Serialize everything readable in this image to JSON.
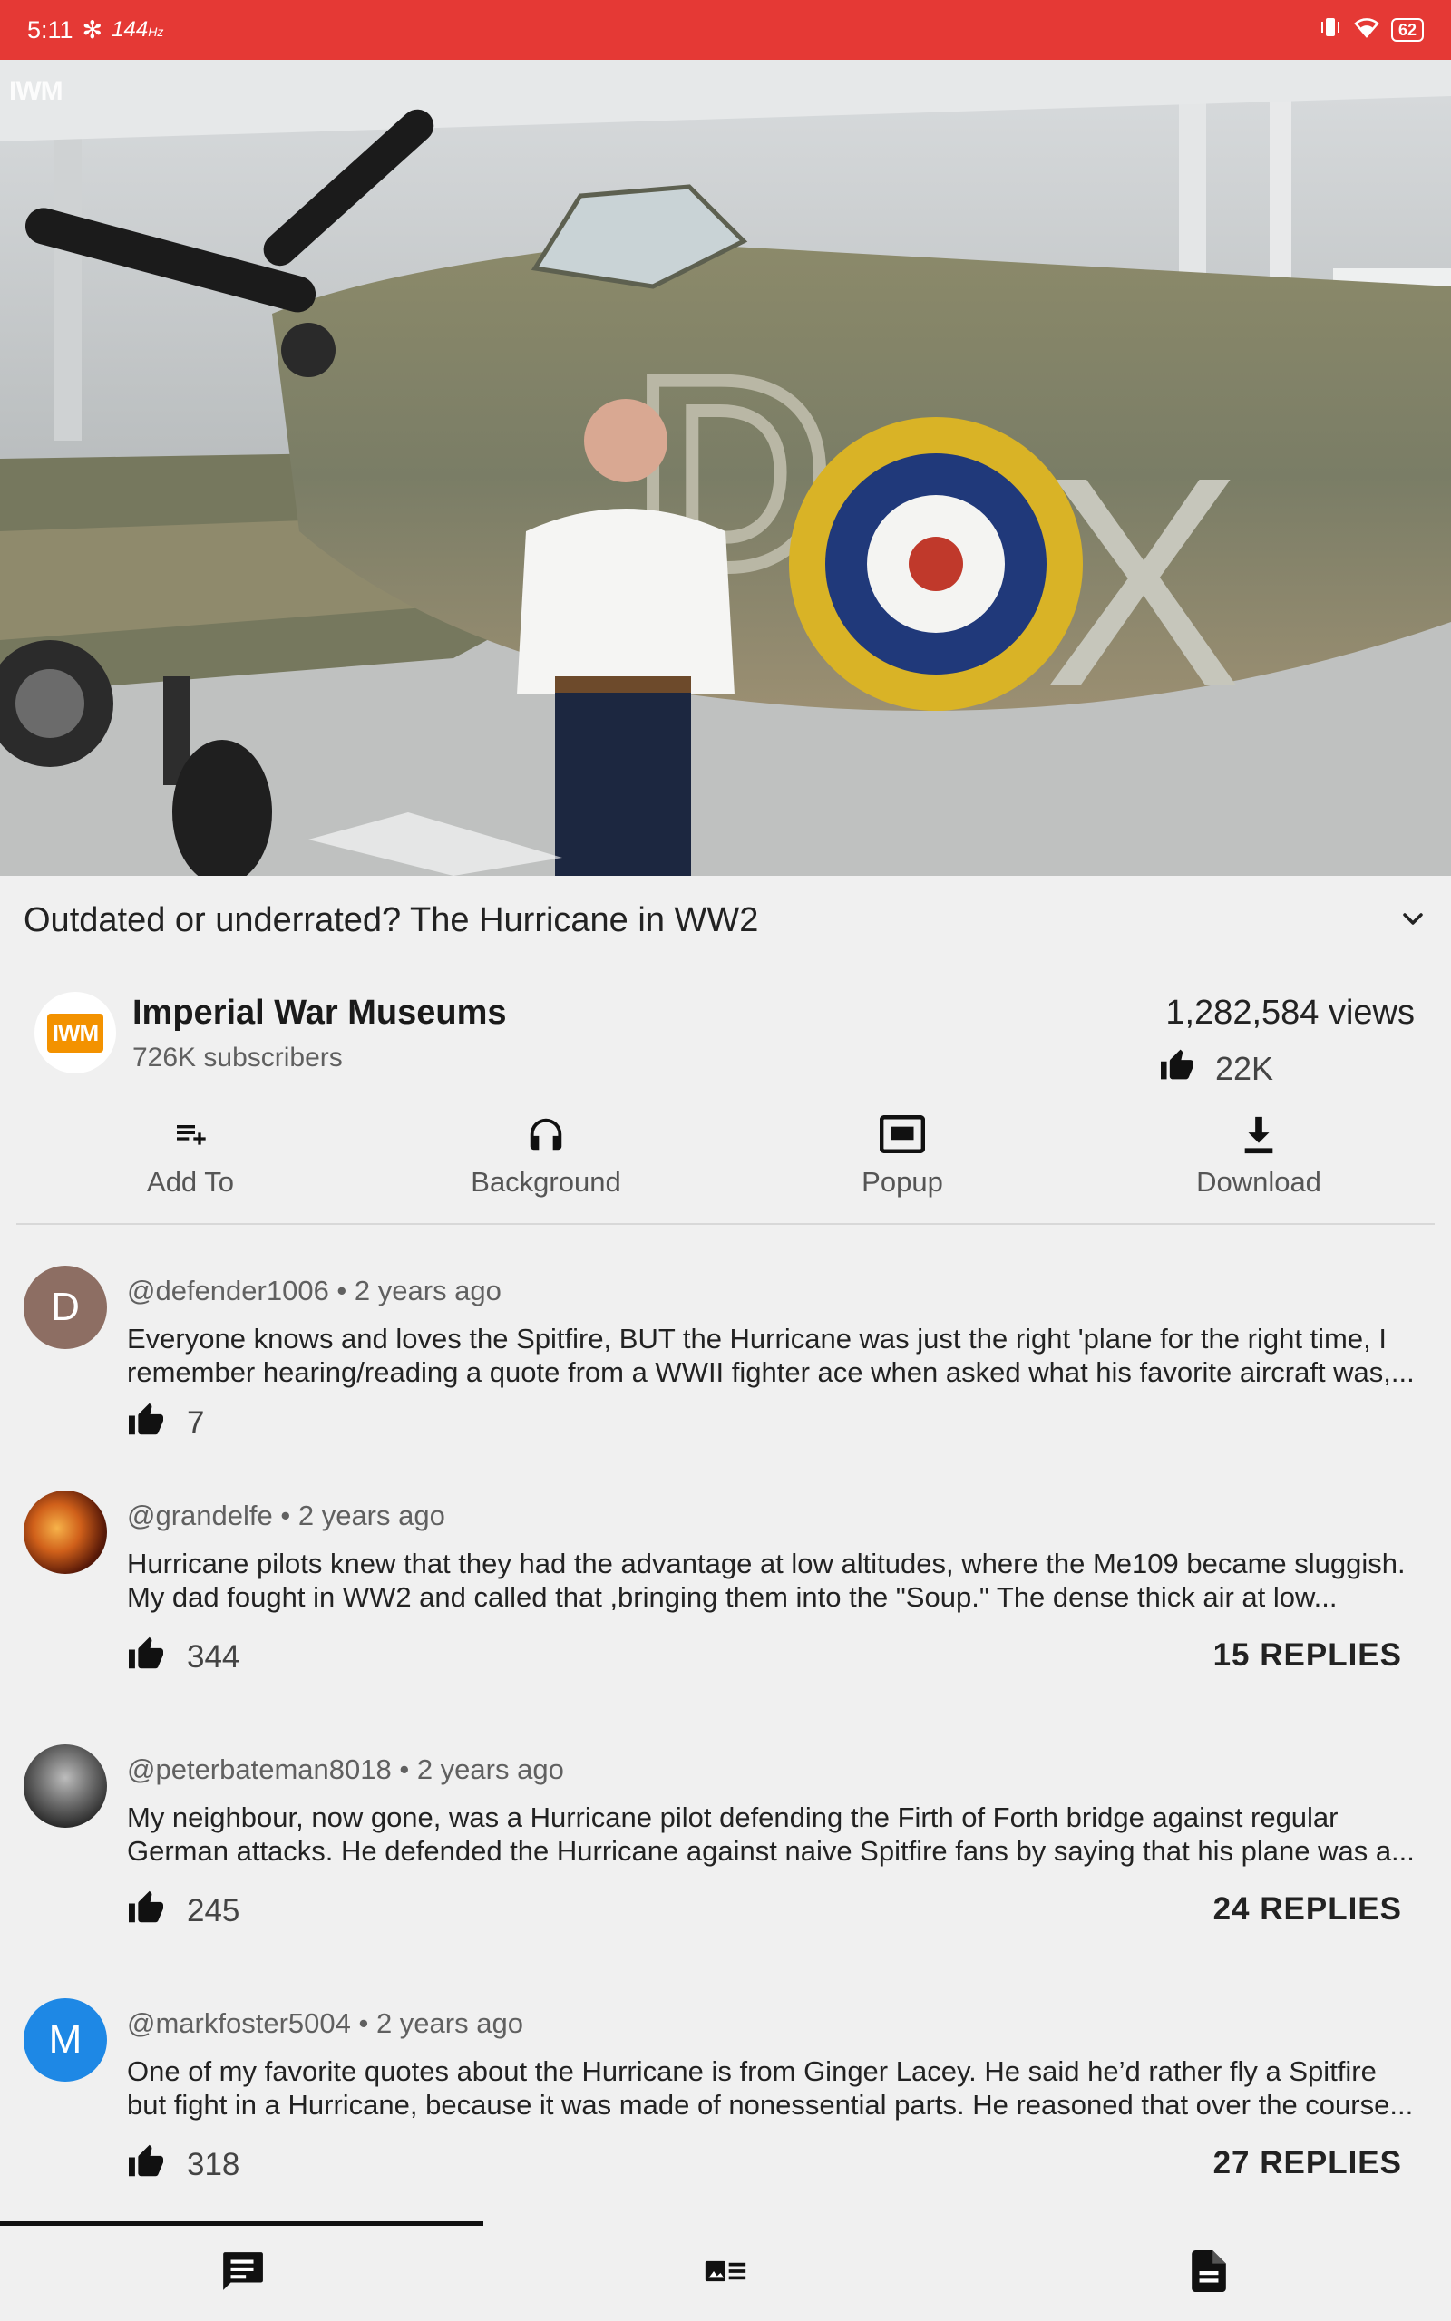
{
  "status_bar": {
    "time": "5:11",
    "refresh_rate": "144",
    "refresh_unit": "Hz",
    "battery": "62"
  },
  "video": {
    "watermark": "IWM",
    "title": "Outdated or underrated? The Hurricane in WW2"
  },
  "channel": {
    "name": "Imperial War Museums",
    "subscribers": "726K subscribers",
    "logo_text": "IWM",
    "views": "1,282,584 views",
    "likes": "22K"
  },
  "actions": [
    {
      "label": "Add To",
      "icon": "playlist-add-icon"
    },
    {
      "label": "Background",
      "icon": "headphones-icon"
    },
    {
      "label": "Popup",
      "icon": "picture-in-picture-icon"
    },
    {
      "label": "Download",
      "icon": "download-icon"
    }
  ],
  "comments": [
    {
      "author": "@defender1006",
      "time": "2 years ago",
      "avatar_letter": "D",
      "avatar_color": "#8d6e63",
      "text1": "Everyone knows and loves the Spitfire, BUT the Hurricane was just the right 'plane for the right time, I",
      "text2": "remember hearing/reading a quote from a WWII fighter ace when asked what his favorite aircraft was,...",
      "likes": "7",
      "replies": ""
    },
    {
      "author": "@grandelfe",
      "time": "2 years ago",
      "avatar_letter": "",
      "avatar_color": "#7a2a0c",
      "text1": "Hurricane pilots knew that they had the advantage at low altitudes, where the Me109 became sluggish.",
      "text2": "My dad fought in WW2 and called that ,bringing them into the \"Soup.\" The dense thick air at low...",
      "likes": "344",
      "replies": "15 REPLIES"
    },
    {
      "author": "@peterbateman8018",
      "time": "2 years ago",
      "avatar_letter": "",
      "avatar_color": "#3a3a3a",
      "text1": "My neighbour, now gone, was a Hurricane pilot defending the Firth of Forth bridge against regular",
      "text2": "German attacks. He defended the Hurricane against naive Spitfire fans by saying that his plane was a...",
      "likes": "245",
      "replies": "24 REPLIES"
    },
    {
      "author": "@markfoster5004",
      "time": "2 years ago",
      "avatar_letter": "M",
      "avatar_color": "#1e88e5",
      "text1": "One of my favorite quotes about the Hurricane is from Ginger Lacey. He said he’d rather fly a Spitfire",
      "text2": "but fight in a Hurricane, because it was made of nonessential parts. He reasoned that over the course...",
      "likes": "318",
      "replies": "27 REPLIES"
    }
  ],
  "tabs": [
    {
      "icon": "comments-icon",
      "selected": true
    },
    {
      "icon": "related-videos-icon",
      "selected": false
    },
    {
      "icon": "description-icon",
      "selected": false
    }
  ],
  "colors": {
    "status_bar": "#e53935",
    "background": "#f0f0f0",
    "iwm_orange": "#f39200"
  }
}
